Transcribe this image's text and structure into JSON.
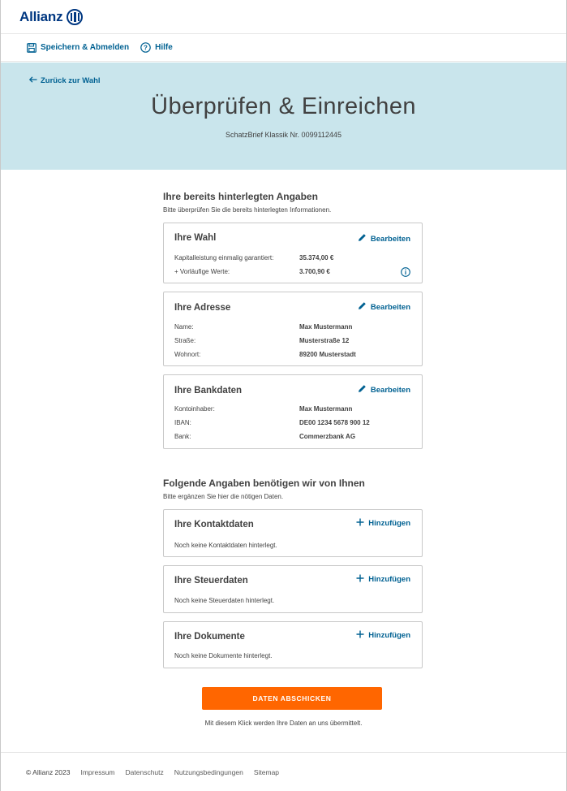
{
  "brand": {
    "name": "Allianz"
  },
  "toolbar": {
    "save_label": "Speichern & Abmelden",
    "help_label": "Hilfe"
  },
  "hero": {
    "back_label": "Zurück zur Wahl",
    "title": "Überprüfen & Einreichen",
    "subtitle": "SchatzBrief Klassik Nr. 0099112445"
  },
  "existing": {
    "title": "Ihre bereits hinterlegten Angaben",
    "subtitle": "Bitte überprüfen Sie die bereits hinterlegten Informationen.",
    "edit_label": "Bearbeiten",
    "cards": [
      {
        "title": "Ihre Wahl",
        "rows": [
          {
            "label": "Kapitalleistung einmalig garantiert:",
            "value": "35.374,00 €"
          },
          {
            "label": "+ Vorläufige Werte:",
            "value": "3.700,90 €"
          }
        ]
      },
      {
        "title": "Ihre Adresse",
        "rows": [
          {
            "label": "Name:",
            "value": "Max Mustermann"
          },
          {
            "label": "Straße:",
            "value": "Musterstraße 12"
          },
          {
            "label": "Wohnort:",
            "value": "89200 Musterstadt"
          }
        ]
      },
      {
        "title": "Ihre Bankdaten",
        "rows": [
          {
            "label": "Kontoinhaber:",
            "value": "Max Mustermann"
          },
          {
            "label": "IBAN:",
            "value": "DE00 1234 5678 900 12"
          },
          {
            "label": "Bank:",
            "value": "Commerzbank AG"
          }
        ]
      }
    ]
  },
  "required": {
    "title": "Folgende Angaben benötigen wir von Ihnen",
    "subtitle": "Bitte ergänzen Sie hier die nötigen Daten.",
    "add_label": "Hinzufügen",
    "cards": [
      {
        "title": "Ihre Kontaktdaten",
        "empty": "Noch keine Kontaktdaten hinterlegt."
      },
      {
        "title": "Ihre Steuerdaten",
        "empty": "Noch keine Steuerdaten hinterlegt."
      },
      {
        "title": "Ihre Dokumente",
        "empty": "Noch keine Dokumente hinterlegt."
      }
    ]
  },
  "submit": {
    "label": "DATEN ABSCHICKEN",
    "note": "Mit diesem Klick werden Ihre Daten an uns übermittelt."
  },
  "footer": {
    "copyright": "© Allianz 2023",
    "links": [
      "Impressum",
      "Datenschutz",
      "Nutzungsbedingungen",
      "Sitemap"
    ]
  },
  "colors": {
    "brand_blue": "#003781",
    "link_blue": "#006192",
    "hero_bg": "#c9e5ec",
    "cta_orange": "#ff6600"
  },
  "icons": [
    "save-icon",
    "help-icon",
    "arrow-left-icon",
    "pencil-icon",
    "plus-icon",
    "info-icon"
  ]
}
